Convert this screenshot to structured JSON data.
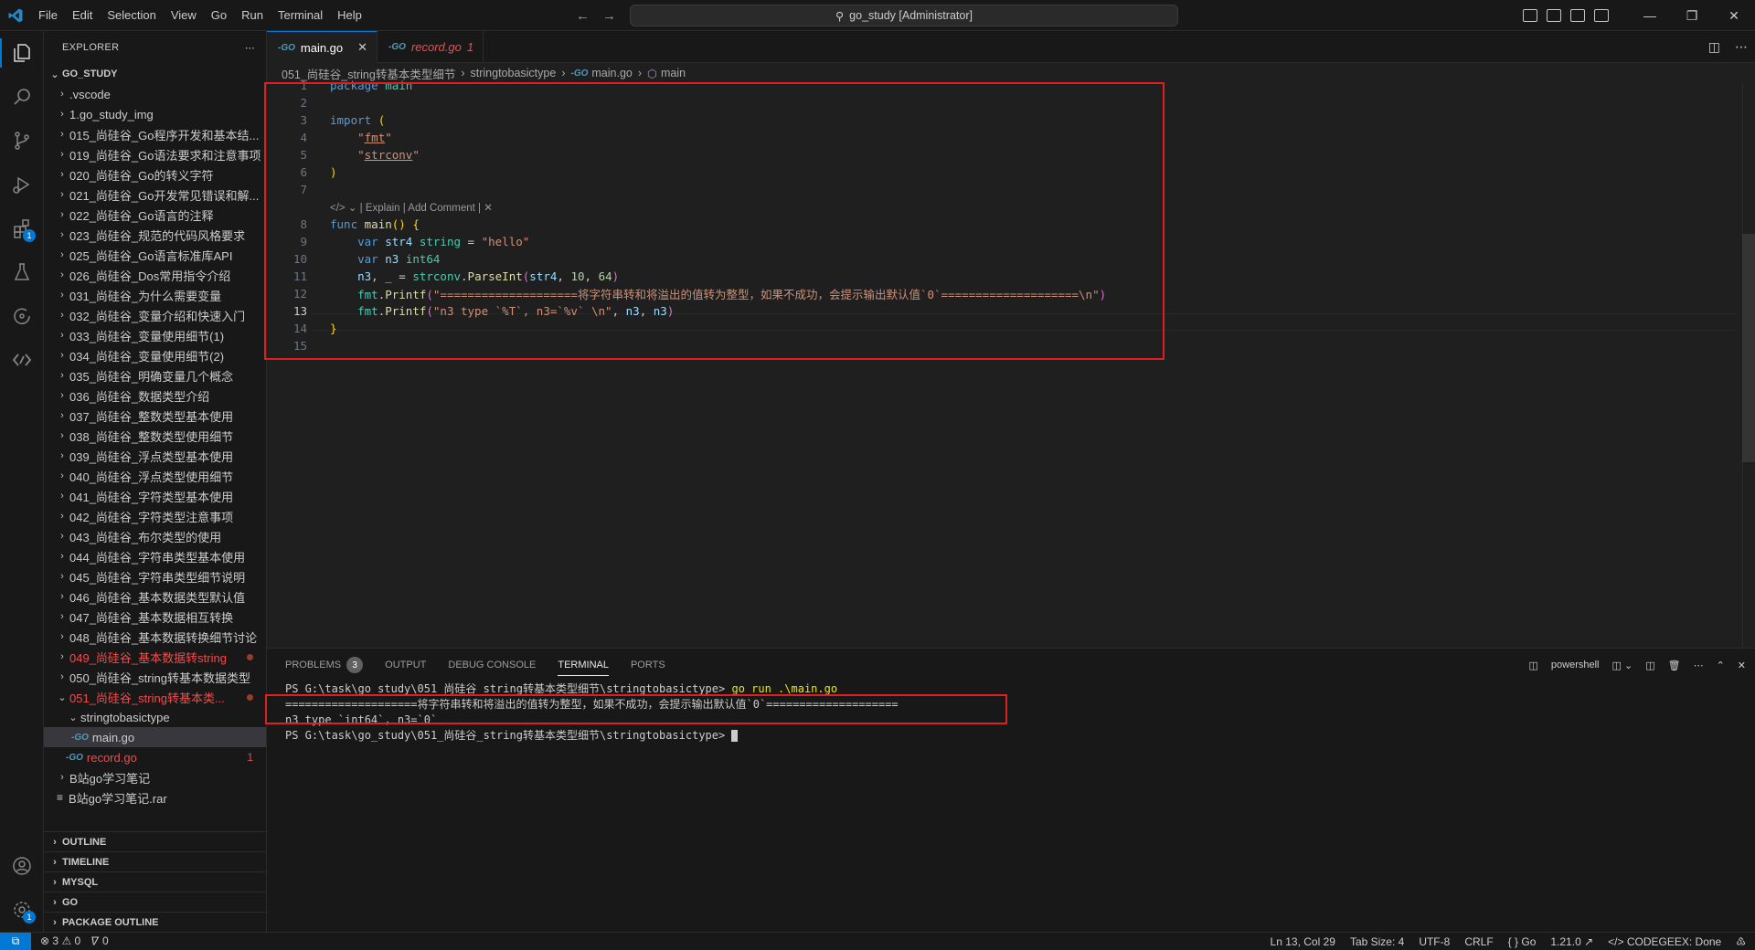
{
  "titlebar": {
    "menu": [
      "File",
      "Edit",
      "Selection",
      "View",
      "Go",
      "Run",
      "Terminal",
      "Help"
    ],
    "command_center": "go_study [Administrator]"
  },
  "activitybar": {
    "extensions_badge": "1",
    "settings_badge": "1"
  },
  "explorer": {
    "header": "EXPLORER",
    "root": "GO_STUDY",
    "items": [
      {
        "label": ".vscode",
        "type": "folder",
        "state": "collapsed"
      },
      {
        "label": "1.go_study_img",
        "type": "folder",
        "state": "collapsed"
      },
      {
        "label": "015_尚硅谷_Go程序开发和基本结...",
        "type": "folder",
        "state": "collapsed"
      },
      {
        "label": "019_尚硅谷_Go语法要求和注意事项",
        "type": "folder",
        "state": "collapsed"
      },
      {
        "label": "020_尚硅谷_Go的转义字符",
        "type": "folder",
        "state": "collapsed"
      },
      {
        "label": "021_尚硅谷_Go开发常见错误和解...",
        "type": "folder",
        "state": "collapsed"
      },
      {
        "label": "022_尚硅谷_Go语言的注释",
        "type": "folder",
        "state": "collapsed"
      },
      {
        "label": "023_尚硅谷_规范的代码风格要求",
        "type": "folder",
        "state": "collapsed"
      },
      {
        "label": "025_尚硅谷_Go语言标准库API",
        "type": "folder",
        "state": "collapsed"
      },
      {
        "label": "026_尚硅谷_Dos常用指令介绍",
        "type": "folder",
        "state": "collapsed"
      },
      {
        "label": "031_尚硅谷_为什么需要变量",
        "type": "folder",
        "state": "collapsed"
      },
      {
        "label": "032_尚硅谷_变量介绍和快速入门",
        "type": "folder",
        "state": "collapsed"
      },
      {
        "label": "033_尚硅谷_变量使用细节(1)",
        "type": "folder",
        "state": "collapsed"
      },
      {
        "label": "034_尚硅谷_变量使用细节(2)",
        "type": "folder",
        "state": "collapsed"
      },
      {
        "label": "035_尚硅谷_明确变量几个概念",
        "type": "folder",
        "state": "collapsed"
      },
      {
        "label": "036_尚硅谷_数据类型介绍",
        "type": "folder",
        "state": "collapsed"
      },
      {
        "label": "037_尚硅谷_整数类型基本使用",
        "type": "folder",
        "state": "collapsed"
      },
      {
        "label": "038_尚硅谷_整数类型使用细节",
        "type": "folder",
        "state": "collapsed"
      },
      {
        "label": "039_尚硅谷_浮点类型基本使用",
        "type": "folder",
        "state": "collapsed"
      },
      {
        "label": "040_尚硅谷_浮点类型使用细节",
        "type": "folder",
        "state": "collapsed"
      },
      {
        "label": "041_尚硅谷_字符类型基本使用",
        "type": "folder",
        "state": "collapsed"
      },
      {
        "label": "042_尚硅谷_字符类型注意事项",
        "type": "folder",
        "state": "collapsed"
      },
      {
        "label": "043_尚硅谷_布尔类型的使用",
        "type": "folder",
        "state": "collapsed"
      },
      {
        "label": "044_尚硅谷_字符串类型基本使用",
        "type": "folder",
        "state": "collapsed"
      },
      {
        "label": "045_尚硅谷_字符串类型细节说明",
        "type": "folder",
        "state": "collapsed"
      },
      {
        "label": "046_尚硅谷_基本数据类型默认值",
        "type": "folder",
        "state": "collapsed"
      },
      {
        "label": "047_尚硅谷_基本数据相互转换",
        "type": "folder",
        "state": "collapsed"
      },
      {
        "label": "048_尚硅谷_基本数据转换细节讨论",
        "type": "folder",
        "state": "collapsed"
      },
      {
        "label": "049_尚硅谷_基本数据转string",
        "type": "folder",
        "state": "collapsed",
        "modified": true
      },
      {
        "label": "050_尚硅谷_string转基本数据类型",
        "type": "folder",
        "state": "collapsed"
      },
      {
        "label": "051_尚硅谷_string转基本类...",
        "type": "folder",
        "state": "expanded",
        "modified": true
      },
      {
        "label": "stringtobasictype",
        "type": "subfolder",
        "state": "expanded"
      },
      {
        "label": "main.go",
        "type": "gofile",
        "selected": true
      },
      {
        "label": "record.go",
        "type": "gofile-root",
        "errors": "1"
      },
      {
        "label": "B站go学习笔记",
        "type": "folder",
        "state": "collapsed"
      },
      {
        "label": "B站go学习笔记.rar",
        "type": "rar"
      }
    ],
    "bottom_sections": [
      "OUTLINE",
      "TIMELINE",
      "MYSQL",
      "GO",
      "PACKAGE OUTLINE"
    ]
  },
  "tabs": [
    {
      "label": "main.go",
      "active": true
    },
    {
      "label": "record.go",
      "badge": "1",
      "active": false
    }
  ],
  "breadcrumb": [
    "051_尚硅谷_string转基本类型细节",
    "stringtobasictype",
    "main.go",
    "main"
  ],
  "editor": {
    "codelens": "| Explain | Add Comment |",
    "current_line": "13",
    "line_numbers": [
      "1",
      "2",
      "3",
      "4",
      "5",
      "6",
      "7",
      "8",
      "9",
      "10",
      "11",
      "12",
      "13",
      "14",
      "15"
    ]
  },
  "panel": {
    "tabs": [
      {
        "label": "PROBLEMS",
        "badge": "3"
      },
      {
        "label": "OUTPUT"
      },
      {
        "label": "DEBUG CONSOLE"
      },
      {
        "label": "TERMINAL",
        "active": true
      },
      {
        "label": "PORTS"
      }
    ],
    "shell": "powershell",
    "terminal": {
      "prompt1": "PS G:\\task\\go_study\\051_尚硅谷_string转基本类型细节\\stringtobasictype> ",
      "command": "go run .\\main.go",
      "output1": "====================将字符串转和将溢出的值转为整型，如果不成功，会提示输出默认值`0`====================",
      "output2": "n3 type `int64`, n3=`0`",
      "prompt2": "PS G:\\task\\go_study\\051_尚硅谷_string转基本类型细节\\stringtobasictype> "
    }
  },
  "statusbar": {
    "errors": "3",
    "warnings": "0",
    "ports": "0",
    "position": "Ln 13, Col 29",
    "tab_size": "Tab Size: 4",
    "encoding": "UTF-8",
    "eol": "CRLF",
    "language": "Go",
    "go_version": "1.21.0",
    "codegeex": "CODEGEEX: Done"
  },
  "colors": {
    "accent": "#0078d4",
    "highlight_box": "#e02020",
    "modified": "#f14c4c"
  }
}
